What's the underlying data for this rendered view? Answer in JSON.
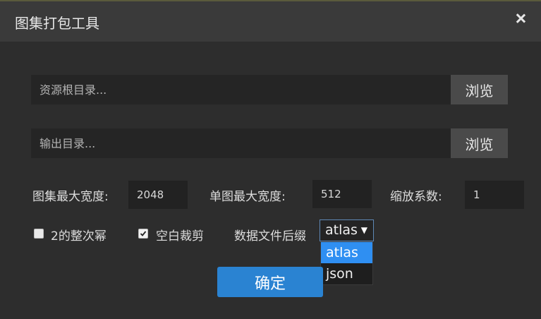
{
  "window": {
    "title": "图集打包工具"
  },
  "source": {
    "placeholder": "资源根目录...",
    "browse_label": "浏览"
  },
  "output": {
    "placeholder": "输出目录...",
    "browse_label": "浏览"
  },
  "settings": {
    "atlas_max_width_label": "图集最大宽度:",
    "atlas_max_width_value": "2048",
    "single_max_width_label": "单图最大宽度:",
    "single_max_width_value": "512",
    "scale_label": "缩放系数:",
    "scale_value": "1"
  },
  "options": {
    "power_of_two_label": "2的整次幂",
    "power_of_two_checked": false,
    "trim_label": "空白裁剪",
    "trim_checked": true,
    "suffix_label": "数据文件后缀",
    "suffix_value": "atlas",
    "suffix_options": [
      "atlas",
      "json"
    ]
  },
  "confirm_label": "确定",
  "colors": {
    "accent": "#2a83d2",
    "selected_option": "#2f8ff2"
  }
}
